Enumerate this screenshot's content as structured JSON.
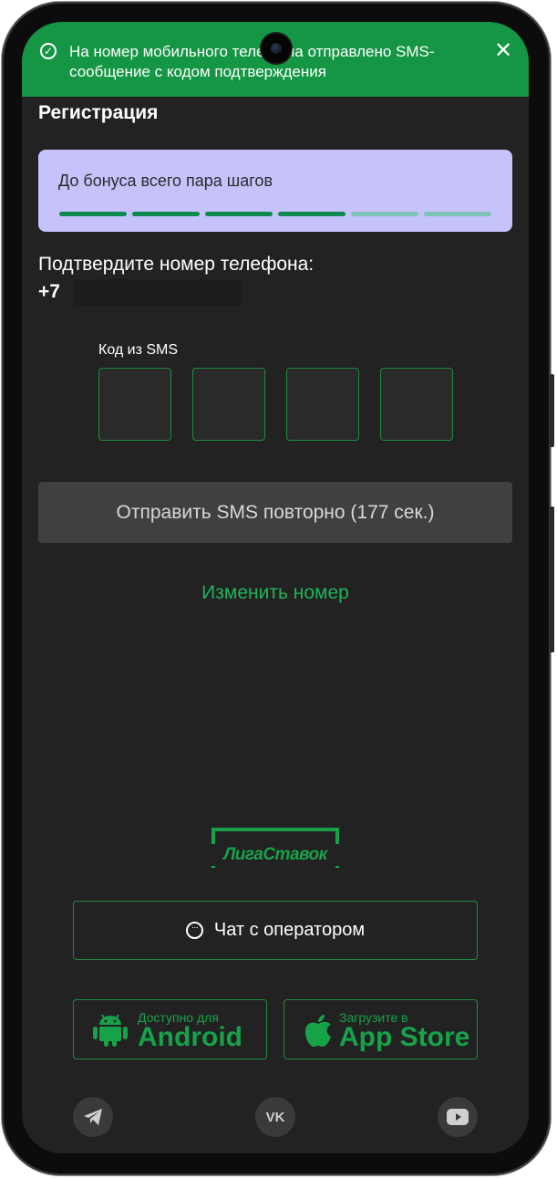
{
  "notification": {
    "text": "На номер мобильного телефона отправлено SMS-сообщение с кодом подтверждения",
    "close_glyph": "✕"
  },
  "page": {
    "title": "Регистрация"
  },
  "bonus": {
    "text": "До бонуса всего пара шагов",
    "steps_total": 6,
    "steps_done": 4
  },
  "phone_confirm": {
    "label": "Подтвердите номер телефона:",
    "prefix": "+7"
  },
  "sms": {
    "label": "Код из SMS",
    "digits": [
      "",
      "",
      "",
      ""
    ]
  },
  "resend_button": {
    "label": "Отправить SMS повторно (177 сек.)"
  },
  "change_number": {
    "label": "Изменить номер"
  },
  "logo": {
    "text": "ЛигаСтавок"
  },
  "chat": {
    "label": "Чат с оператором"
  },
  "stores": {
    "android": {
      "small": "Доступно для",
      "big": "Android"
    },
    "apple": {
      "small": "Загрузите в",
      "big": "App Store"
    }
  },
  "social": {
    "vk_text": "VK"
  },
  "colors": {
    "notification_bg": "#149644",
    "accent_green": "#17a24a",
    "bonus_card_bg": "#c6c3fc",
    "step_done": "#0d8a4f",
    "step_pending": "#7fc2b8",
    "screen_bg": "#222222",
    "resend_bg": "#404040"
  },
  "icons": {
    "notification": "check-circle-icon",
    "close": "close-icon",
    "chat": "chat-bubble-icon",
    "android": "android-icon",
    "apple": "apple-icon",
    "telegram": "telegram-icon",
    "vk": "vk-icon",
    "youtube": "youtube-icon"
  }
}
